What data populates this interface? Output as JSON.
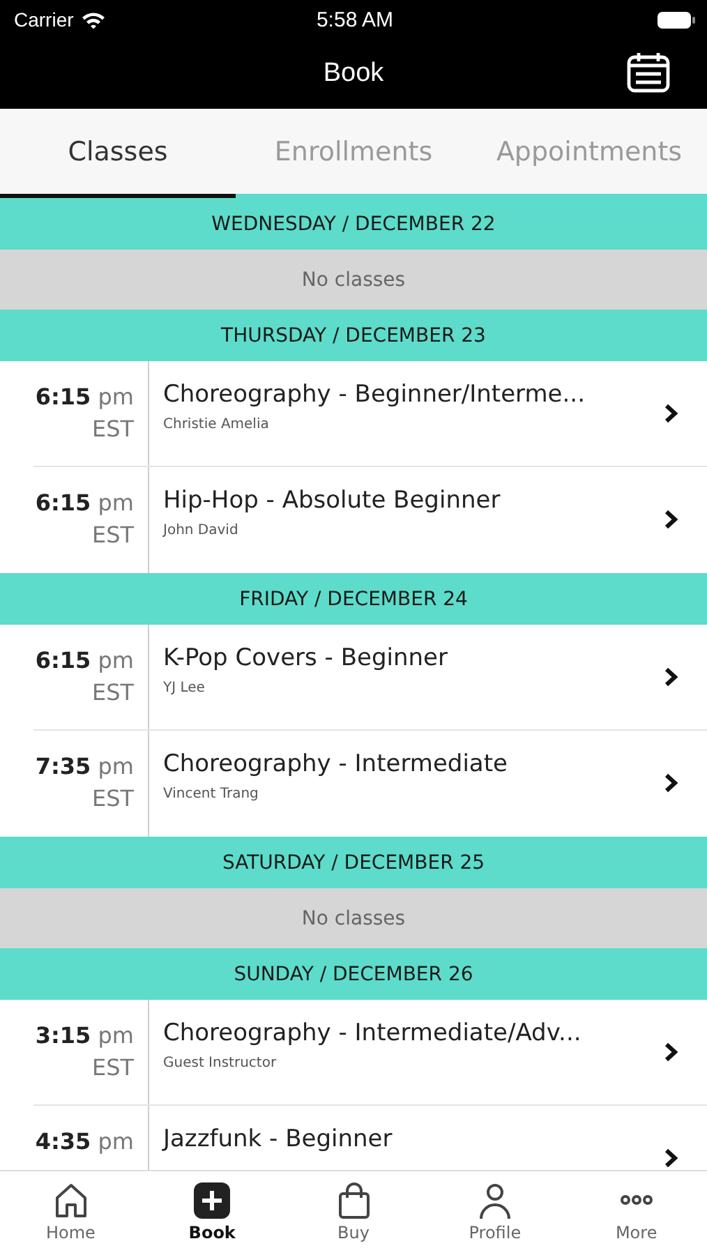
{
  "status_bar": {
    "carrier": "Carrier",
    "time": "5:58 AM"
  },
  "nav": {
    "title": "Book"
  },
  "tabs": [
    {
      "label": "Classes",
      "selected": true
    },
    {
      "label": "Enrollments",
      "selected": false
    },
    {
      "label": "Appointments",
      "selected": false
    }
  ],
  "days": [
    {
      "date": "WEDNESDAY / DECEMBER 22",
      "empty_text": "No classes"
    },
    {
      "date": "THURSDAY / DECEMBER 23",
      "classes": [
        {
          "time": "6:15",
          "ampm": "pm",
          "zone": "EST",
          "title": "Choreography - Beginner/Interme...",
          "instructor": "Christie Amelia"
        },
        {
          "time": "6:15",
          "ampm": "pm",
          "zone": "EST",
          "title": "Hip-Hop - Absolute Beginner",
          "instructor": "John David"
        }
      ]
    },
    {
      "date": "FRIDAY / DECEMBER 24",
      "classes": [
        {
          "time": "6:15",
          "ampm": "pm",
          "zone": "EST",
          "title": "K-Pop Covers - Beginner",
          "instructor": "YJ Lee"
        },
        {
          "time": "7:35",
          "ampm": "pm",
          "zone": "EST",
          "title": "Choreography - Intermediate",
          "instructor": "Vincent Trang"
        }
      ]
    },
    {
      "date": "SATURDAY / DECEMBER 25",
      "empty_text": "No classes"
    },
    {
      "date": "SUNDAY / DECEMBER 26",
      "classes": [
        {
          "time": "3:15",
          "ampm": "pm",
          "zone": "EST",
          "title": "Choreography - Intermediate/Adv...",
          "instructor": "Guest Instructor"
        },
        {
          "time": "4:35",
          "ampm": "pm",
          "title": "Jazzfunk - Beginner"
        }
      ]
    }
  ],
  "tab_bar": [
    {
      "kind": "home",
      "label": "Home",
      "selected": false
    },
    {
      "kind": "book",
      "label": "Book",
      "selected": true
    },
    {
      "kind": "buy",
      "label": "Buy",
      "selected": false
    },
    {
      "kind": "profile",
      "label": "Profile",
      "selected": false
    },
    {
      "kind": "more",
      "label": "More",
      "selected": false
    }
  ]
}
